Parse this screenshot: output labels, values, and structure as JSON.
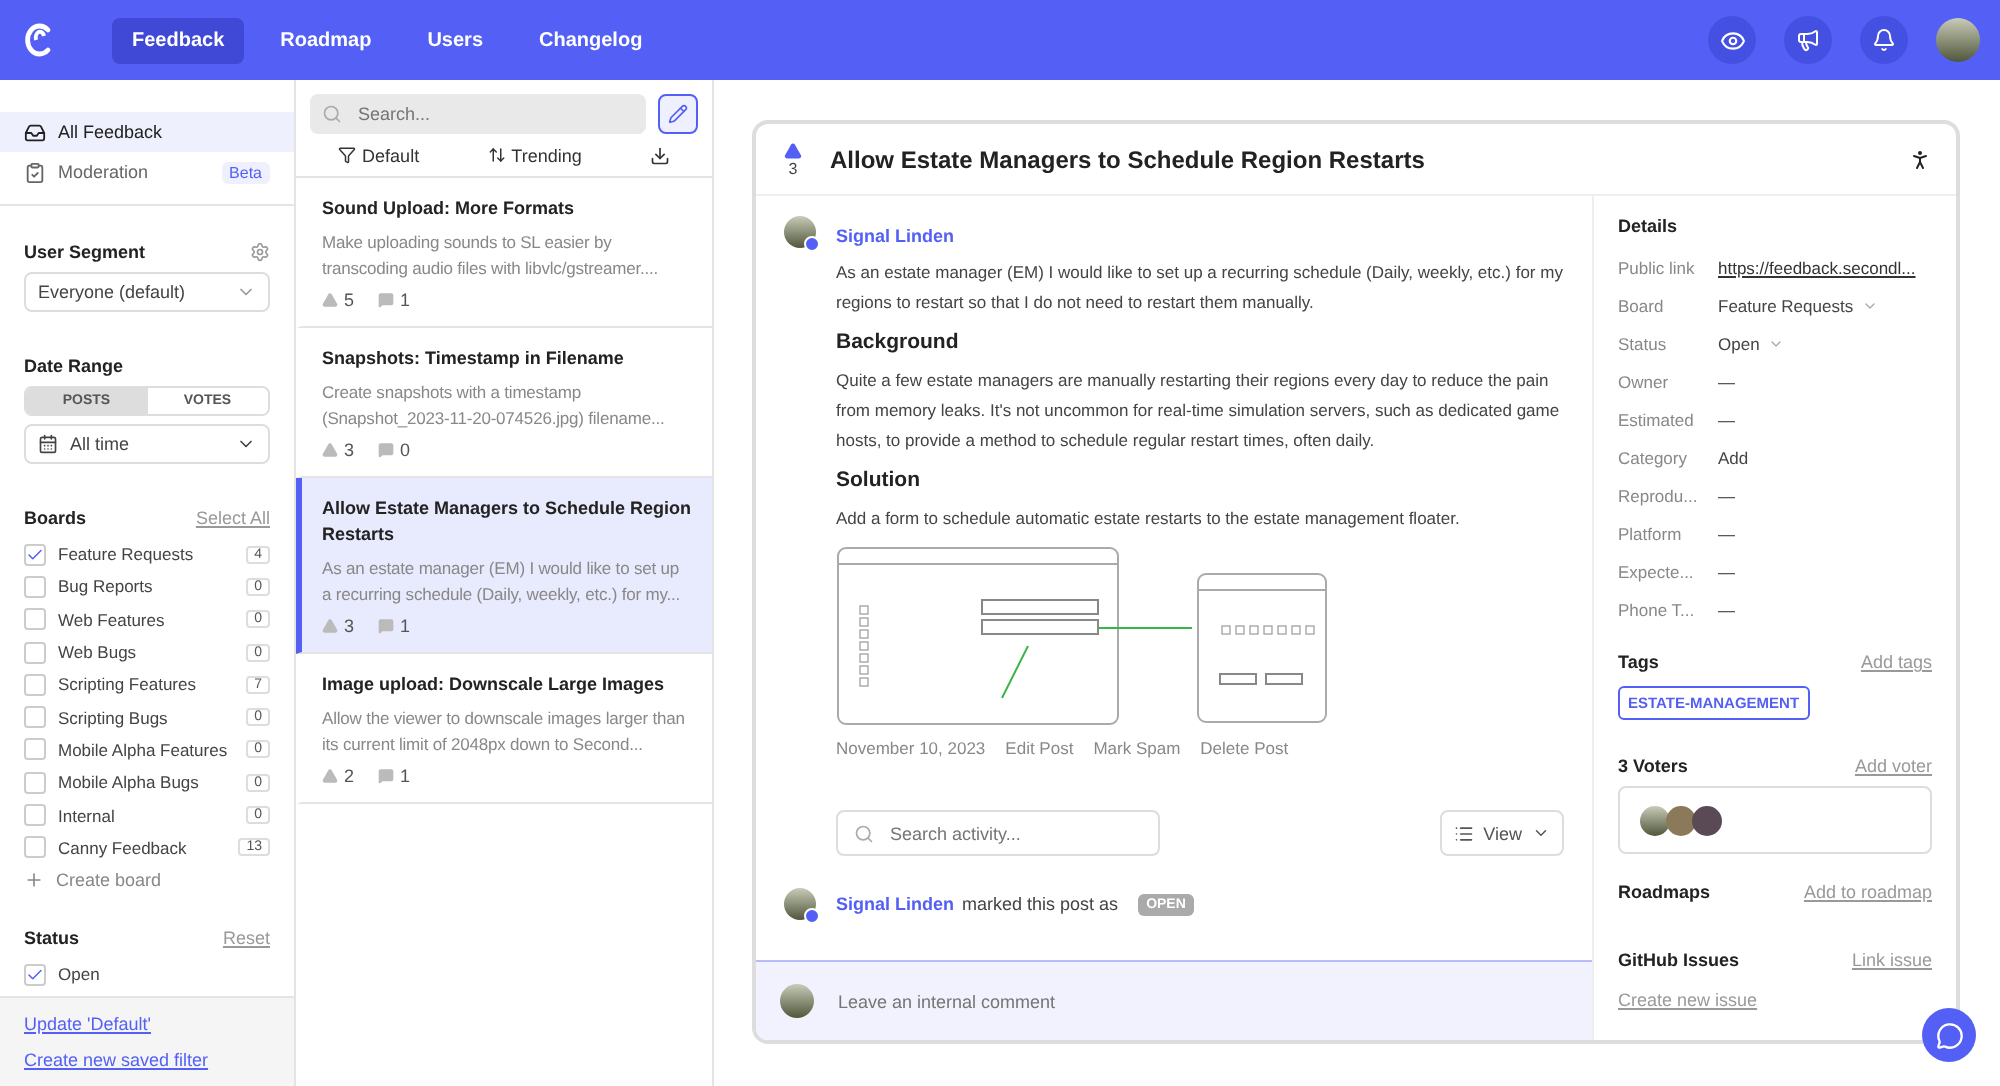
{
  "nav": {
    "items": [
      {
        "label": "Feedback",
        "selected": true
      },
      {
        "label": "Roadmap",
        "selected": false
      },
      {
        "label": "Users",
        "selected": false
      },
      {
        "label": "Changelog",
        "selected": false
      }
    ]
  },
  "sidebar": {
    "views": [
      {
        "label": "All Feedback",
        "selected": true
      },
      {
        "label": "Moderation",
        "selected": false,
        "badge": "Beta"
      }
    ],
    "user_segment": {
      "title": "User Segment",
      "value": "Everyone (default)"
    },
    "date_range": {
      "title": "Date Range",
      "tabs": [
        {
          "label": "POSTS",
          "selected": true
        },
        {
          "label": "VOTES",
          "selected": false
        }
      ],
      "value": "All time"
    },
    "boards": {
      "title": "Boards",
      "action": "Select All",
      "items": [
        {
          "label": "Feature Requests",
          "count": "4",
          "checked": true
        },
        {
          "label": "Bug Reports",
          "count": "0",
          "checked": false
        },
        {
          "label": "Web Features",
          "count": "0",
          "checked": false
        },
        {
          "label": "Web Bugs",
          "count": "0",
          "checked": false
        },
        {
          "label": "Scripting Features",
          "count": "7",
          "checked": false
        },
        {
          "label": "Scripting Bugs",
          "count": "0",
          "checked": false
        },
        {
          "label": "Mobile Alpha Features",
          "count": "0",
          "checked": false
        },
        {
          "label": "Mobile Alpha Bugs",
          "count": "0",
          "checked": false
        },
        {
          "label": "Internal",
          "count": "0",
          "checked": false
        },
        {
          "label": "Canny Feedback",
          "count": "13",
          "checked": false
        }
      ],
      "create": "Create board"
    },
    "status": {
      "title": "Status",
      "action": "Reset",
      "items": [
        {
          "label": "Open",
          "checked": true
        }
      ]
    },
    "footer_links": [
      "Update 'Default'",
      "Create new saved filter"
    ]
  },
  "list": {
    "search": {
      "placeholder": "Search..."
    },
    "sort": [
      "Default",
      "Trending"
    ],
    "posts": [
      {
        "title": "Sound Upload: More Formats",
        "excerpt": "Make uploading sounds to SL easier by transcoding audio files with libvlc/gstreamer....",
        "votes": "5",
        "comments": "1",
        "selected": false
      },
      {
        "title": "Snapshots: Timestamp in Filename",
        "excerpt": "Create snapshots with a timestamp (Snapshot_2023-11-20-074526.jpg) filename...",
        "votes": "3",
        "comments": "0",
        "selected": false
      },
      {
        "title": "Allow Estate Managers to Schedule Region Restarts",
        "excerpt": "As an estate manager (EM) I would like to set up a recurring schedule (Daily, weekly, etc.) for my...",
        "votes": "3",
        "comments": "1",
        "selected": true
      },
      {
        "title": "Image upload: Downscale Large Images",
        "excerpt": "Allow the viewer to downscale images larger than its current limit of 2048px down to Second...",
        "votes": "2",
        "comments": "1",
        "selected": false
      }
    ]
  },
  "post": {
    "votes": "3",
    "title": "Allow Estate Managers to Schedule Region Restarts",
    "author": "Signal Linden",
    "content": [
      {
        "kind": "paragraph",
        "text": "As an estate manager (EM) I would like to set up a recurring schedule (Daily, weekly, etc.) for my regions to restart so that I do not need to restart them manually."
      },
      {
        "kind": "heading",
        "text": "Background"
      },
      {
        "kind": "paragraph",
        "text": "Quite a few estate managers are manually restarting their regions every day to reduce the pain from memory leaks. It's not uncommon for real-time simulation servers, such as dedicated game hosts, to provide a method to schedule regular restart times, often daily."
      },
      {
        "kind": "heading",
        "text": "Solution"
      },
      {
        "kind": "paragraph",
        "text": "Add a form to schedule automatic estate restarts to the estate management floater."
      },
      {
        "kind": "image"
      }
    ],
    "date": "November 10, 2023",
    "actions": [
      "Edit Post",
      "Mark Spam",
      "Delete Post"
    ],
    "activity_search": {
      "placeholder": "Search activity..."
    },
    "view_button": "View",
    "activity": {
      "author": "Signal Linden",
      "text": "marked this post as",
      "status": "OPEN"
    },
    "comment": {
      "placeholder": "Leave an internal comment"
    }
  },
  "details": {
    "title": "Details",
    "rows": [
      {
        "label": "Public link",
        "value": "https://feedback.secondl...",
        "kind": "link"
      },
      {
        "label": "Board",
        "value": "Feature Requests",
        "kind": "select"
      },
      {
        "label": "Status",
        "value": "Open",
        "kind": "select"
      },
      {
        "label": "Owner",
        "value": "—",
        "kind": "text"
      },
      {
        "label": "Estimated",
        "value": "—",
        "kind": "text"
      },
      {
        "label": "Category",
        "value": "Add",
        "kind": "text"
      },
      {
        "label": "Reprodu...",
        "value": "—",
        "kind": "text"
      },
      {
        "label": "Platform",
        "value": "—",
        "kind": "text"
      },
      {
        "label": "Expecte...",
        "value": "—",
        "kind": "text"
      },
      {
        "label": "Phone T...",
        "value": "—",
        "kind": "text"
      }
    ],
    "tags": {
      "title": "Tags",
      "action": "Add tags",
      "items": [
        "ESTATE-MANAGEMENT"
      ]
    },
    "voters": {
      "title": "3 Voters",
      "action": "Add voter"
    },
    "roadmaps": {
      "title": "Roadmaps",
      "action": "Add to roadmap"
    },
    "github": {
      "title": "GitHub Issues",
      "action": "Link issue",
      "link": "Create new issue"
    }
  }
}
